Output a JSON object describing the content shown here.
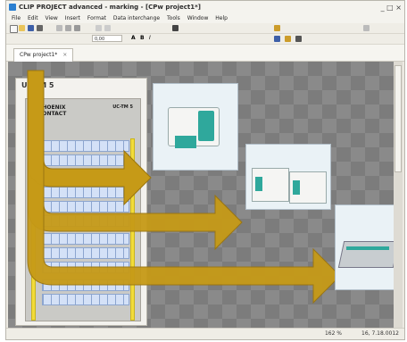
{
  "window": {
    "title": "CLIP PROJECT advanced - marking - [CPw project1*]",
    "controls": "_ □ ×"
  },
  "menu": [
    "File",
    "Edit",
    "View",
    "Insert",
    "Format",
    "Data interchange",
    "Tools",
    "Window",
    "Help"
  ],
  "toolbar": {
    "value_field": "0,00",
    "tool_labels": [
      "A",
      "B",
      "I"
    ]
  },
  "tab": {
    "label": "CPw project1*"
  },
  "panel": {
    "title": "UC-TM 5"
  },
  "board": {
    "logo_line1": "PHOENIX",
    "logo_line2": "CONTACT",
    "model": "UC-TM 5"
  },
  "status": {
    "zoom": "162 %",
    "position": "16, 7.18.0012"
  },
  "colors": {
    "arrow": "#c69a17",
    "arrow_dark": "#9a7510",
    "canvas": "#8a8a8a",
    "yellow_bar": "#f2dc3a",
    "marker_blue": "#d4e1f7"
  },
  "icons": [
    "new-icon",
    "open-icon",
    "save-icon",
    "print-icon",
    "cut-icon",
    "copy-icon",
    "paste-icon",
    "undo-icon",
    "redo-icon",
    "zoom-icon"
  ]
}
